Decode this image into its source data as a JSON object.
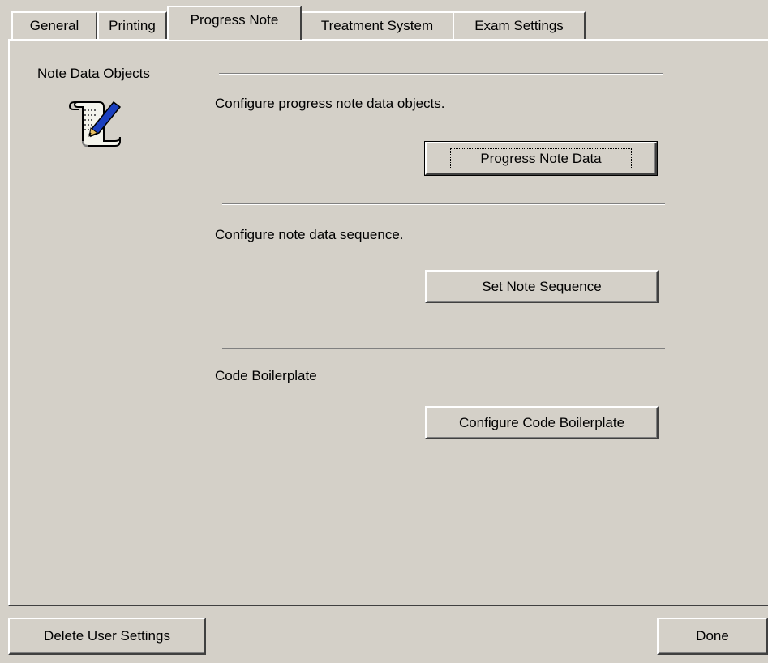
{
  "tabs": [
    {
      "label": "General"
    },
    {
      "label": "Printing"
    },
    {
      "label": "Progress Note"
    },
    {
      "label": "Treatment System"
    },
    {
      "label": "Exam Settings"
    }
  ],
  "active_tab": "Progress Note",
  "panel": {
    "section_title": "Note Data Objects",
    "section_icon": "scroll-with-pen-icon",
    "groups": [
      {
        "description": "Configure progress note data objects.",
        "button": "Progress Note Data"
      },
      {
        "description": "Configure note data sequence.",
        "button": "Set Note Sequence"
      },
      {
        "description": "Code Boilerplate",
        "button": "Configure Code Boilerplate"
      }
    ]
  },
  "footer": {
    "delete_button": "Delete User Settings",
    "done_button": "Done"
  },
  "colors": {
    "face": "#d4d0c8",
    "highlight": "#ffffff",
    "shadow": "#808080",
    "dark_shadow": "#404040",
    "icon_pen": "#1a3fbf",
    "icon_paper": "#f4f4ec"
  }
}
